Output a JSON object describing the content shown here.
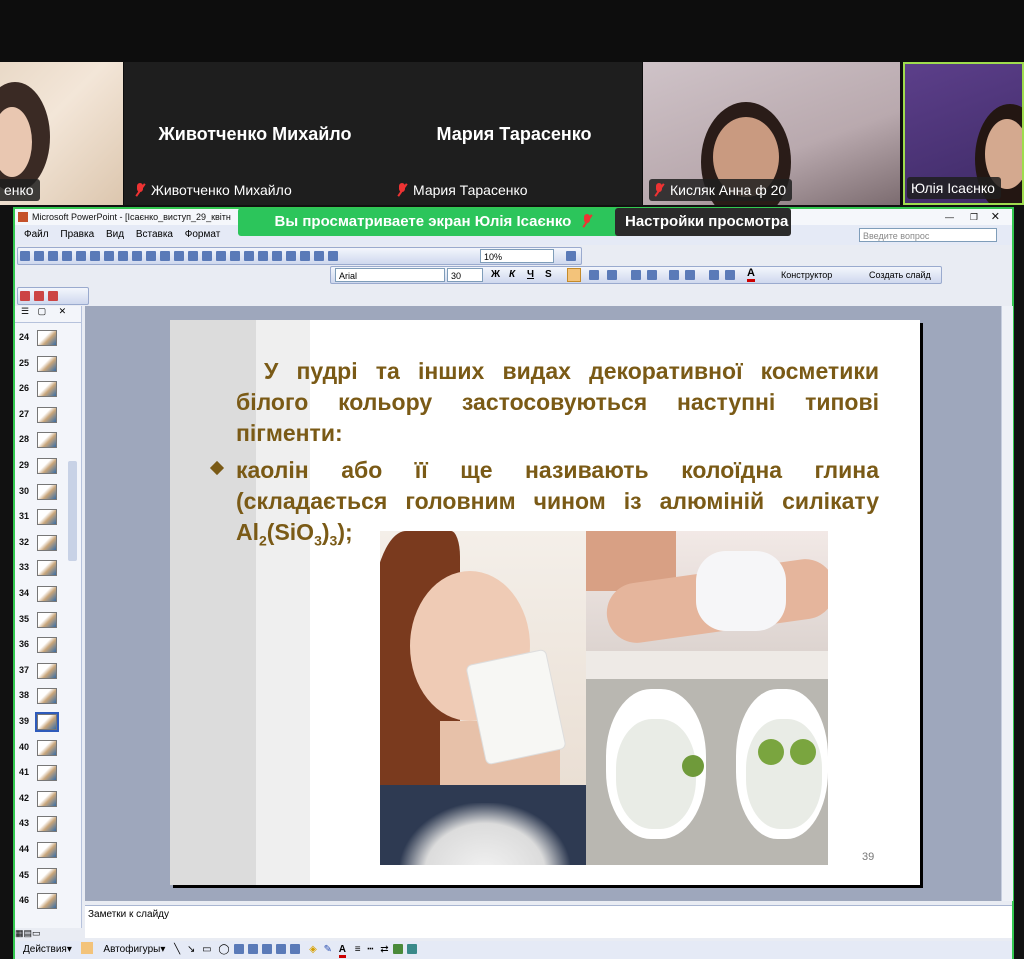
{
  "participants": [
    {
      "name": "енко",
      "muted": false
    },
    {
      "name": "Животченко Михайло",
      "muted": true
    },
    {
      "name": "Мария Тарасенко",
      "muted": true
    },
    {
      "name": "Кисляк Анна ф 20",
      "muted": true
    },
    {
      "name": "Юлія Ісаєнко",
      "muted": false
    }
  ],
  "banner": {
    "viewing": "Вы просматриваете экран  Юлія Ісаєнко",
    "settings": "Настройки просмотра"
  },
  "ppt": {
    "title": "Microsoft PowerPoint - [Ісаєнко_виступ_29_квітн",
    "menu": [
      "Файл",
      "Правка",
      "Вид",
      "Вставка",
      "Формат"
    ],
    "zoom": "10%",
    "help_placeholder": "Введите вопрос",
    "font": "Arial",
    "font_size": "30",
    "format_buttons": [
      "Ж",
      "К",
      "Ч",
      "S"
    ],
    "designer": "Конструктор",
    "new_slide": "Создать слайд",
    "thumb_numbers": [
      "24",
      "25",
      "26",
      "27",
      "28",
      "29",
      "30",
      "31",
      "32",
      "33",
      "34",
      "35",
      "36",
      "37",
      "38",
      "39",
      "40",
      "41",
      "42",
      "43",
      "44",
      "45",
      "46"
    ],
    "selected_slide": "39",
    "notes_placeholder": "Заметки к слайду",
    "draw_menu": "Действия",
    "autoshapes": "Автофигуры"
  },
  "slide": {
    "intro": "У пудрі та інших видах декоративної косметики білого кольору застосовуються наступні типові пігменти:",
    "bullet": "каолін або її ще називають колоїдна глина (складається головним чином із алюміній силікату Al",
    "formula_sub1": "2",
    "formula_mid": "(SiO",
    "formula_sub2": "3",
    "formula_end": ")",
    "formula_sub3": "3",
    "formula_tail": ");",
    "page_number": "39"
  }
}
